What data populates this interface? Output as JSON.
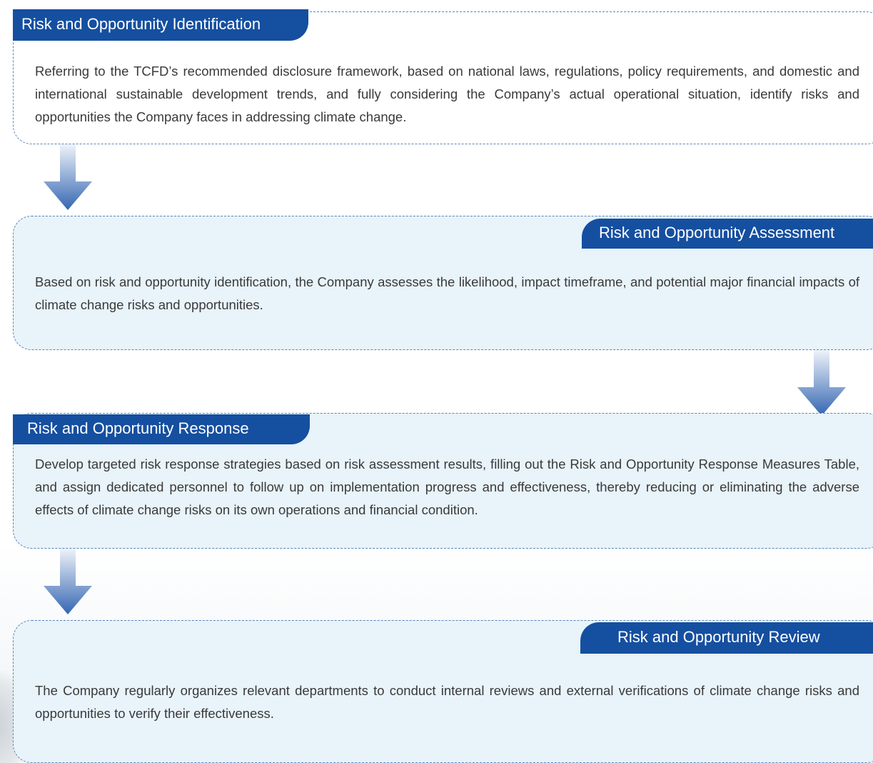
{
  "steps": [
    {
      "title": "Risk and Opportunity Identification",
      "text": "Referring to the TCFD’s recommended disclosure framework, based on national laws, regulations, policy requirements, and domestic and international sustainable development trends, and fully considering the Company’s actual operational situation, identify risks and opportunities the Company faces in addressing climate change."
    },
    {
      "title": "Risk and Opportunity Assessment",
      "text": "Based on risk and opportunity identification, the Company assesses the likelihood, impact timeframe, and potential major financial impacts of climate change risks and opportunities."
    },
    {
      "title": "Risk and Opportunity Response",
      "text": "Develop targeted risk response strategies based on risk assessment results, filling out the Risk and Opportunity Response Measures Table, and assign dedicated personnel to follow up on implementation progress and effectiveness, thereby reducing or eliminating the adverse effects of climate change risks on its own operations and financial condition."
    },
    {
      "title": "Risk and Opportunity Review",
      "text": "The Company regularly organizes relevant departments to conduct internal reviews and external verifications of climate change risks and opportunities to verify their effectiveness."
    }
  ],
  "colors": {
    "tag_background": "#154fa0",
    "box_border": "#5b86b8",
    "box_fill": "#e8f3fa",
    "arrow_top": "#e9f0f8",
    "arrow_bottom": "#3566b2"
  },
  "icons": [
    "down-arrow-icon",
    "down-arrow-icon",
    "down-arrow-icon"
  ]
}
